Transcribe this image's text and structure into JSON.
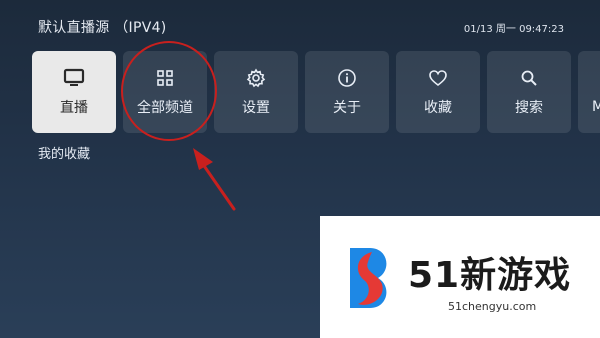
{
  "header": {
    "source_title": "默认直播源 （IPV4)",
    "datetime": "01/13 周一 09:47:23"
  },
  "menu": [
    {
      "label": "直播",
      "icon": "tv-icon",
      "active": true
    },
    {
      "label": "全部频道",
      "icon": "grid-icon",
      "active": false
    },
    {
      "label": "设置",
      "icon": "gear-icon",
      "active": false
    },
    {
      "label": "关于",
      "icon": "info-icon",
      "active": false
    },
    {
      "label": "收藏",
      "icon": "heart-icon",
      "active": false
    },
    {
      "label": "搜索",
      "icon": "search-icon",
      "active": false
    },
    {
      "label": "M",
      "icon": "partial-icon",
      "active": false
    }
  ],
  "favorites_label": "我的收藏",
  "annotation": {
    "color": "#c8201e"
  },
  "watermark": {
    "brand": "51新游戏",
    "url": "51chengyu.com",
    "colors": {
      "red": "#e53935",
      "blue": "#1e88e5"
    }
  }
}
